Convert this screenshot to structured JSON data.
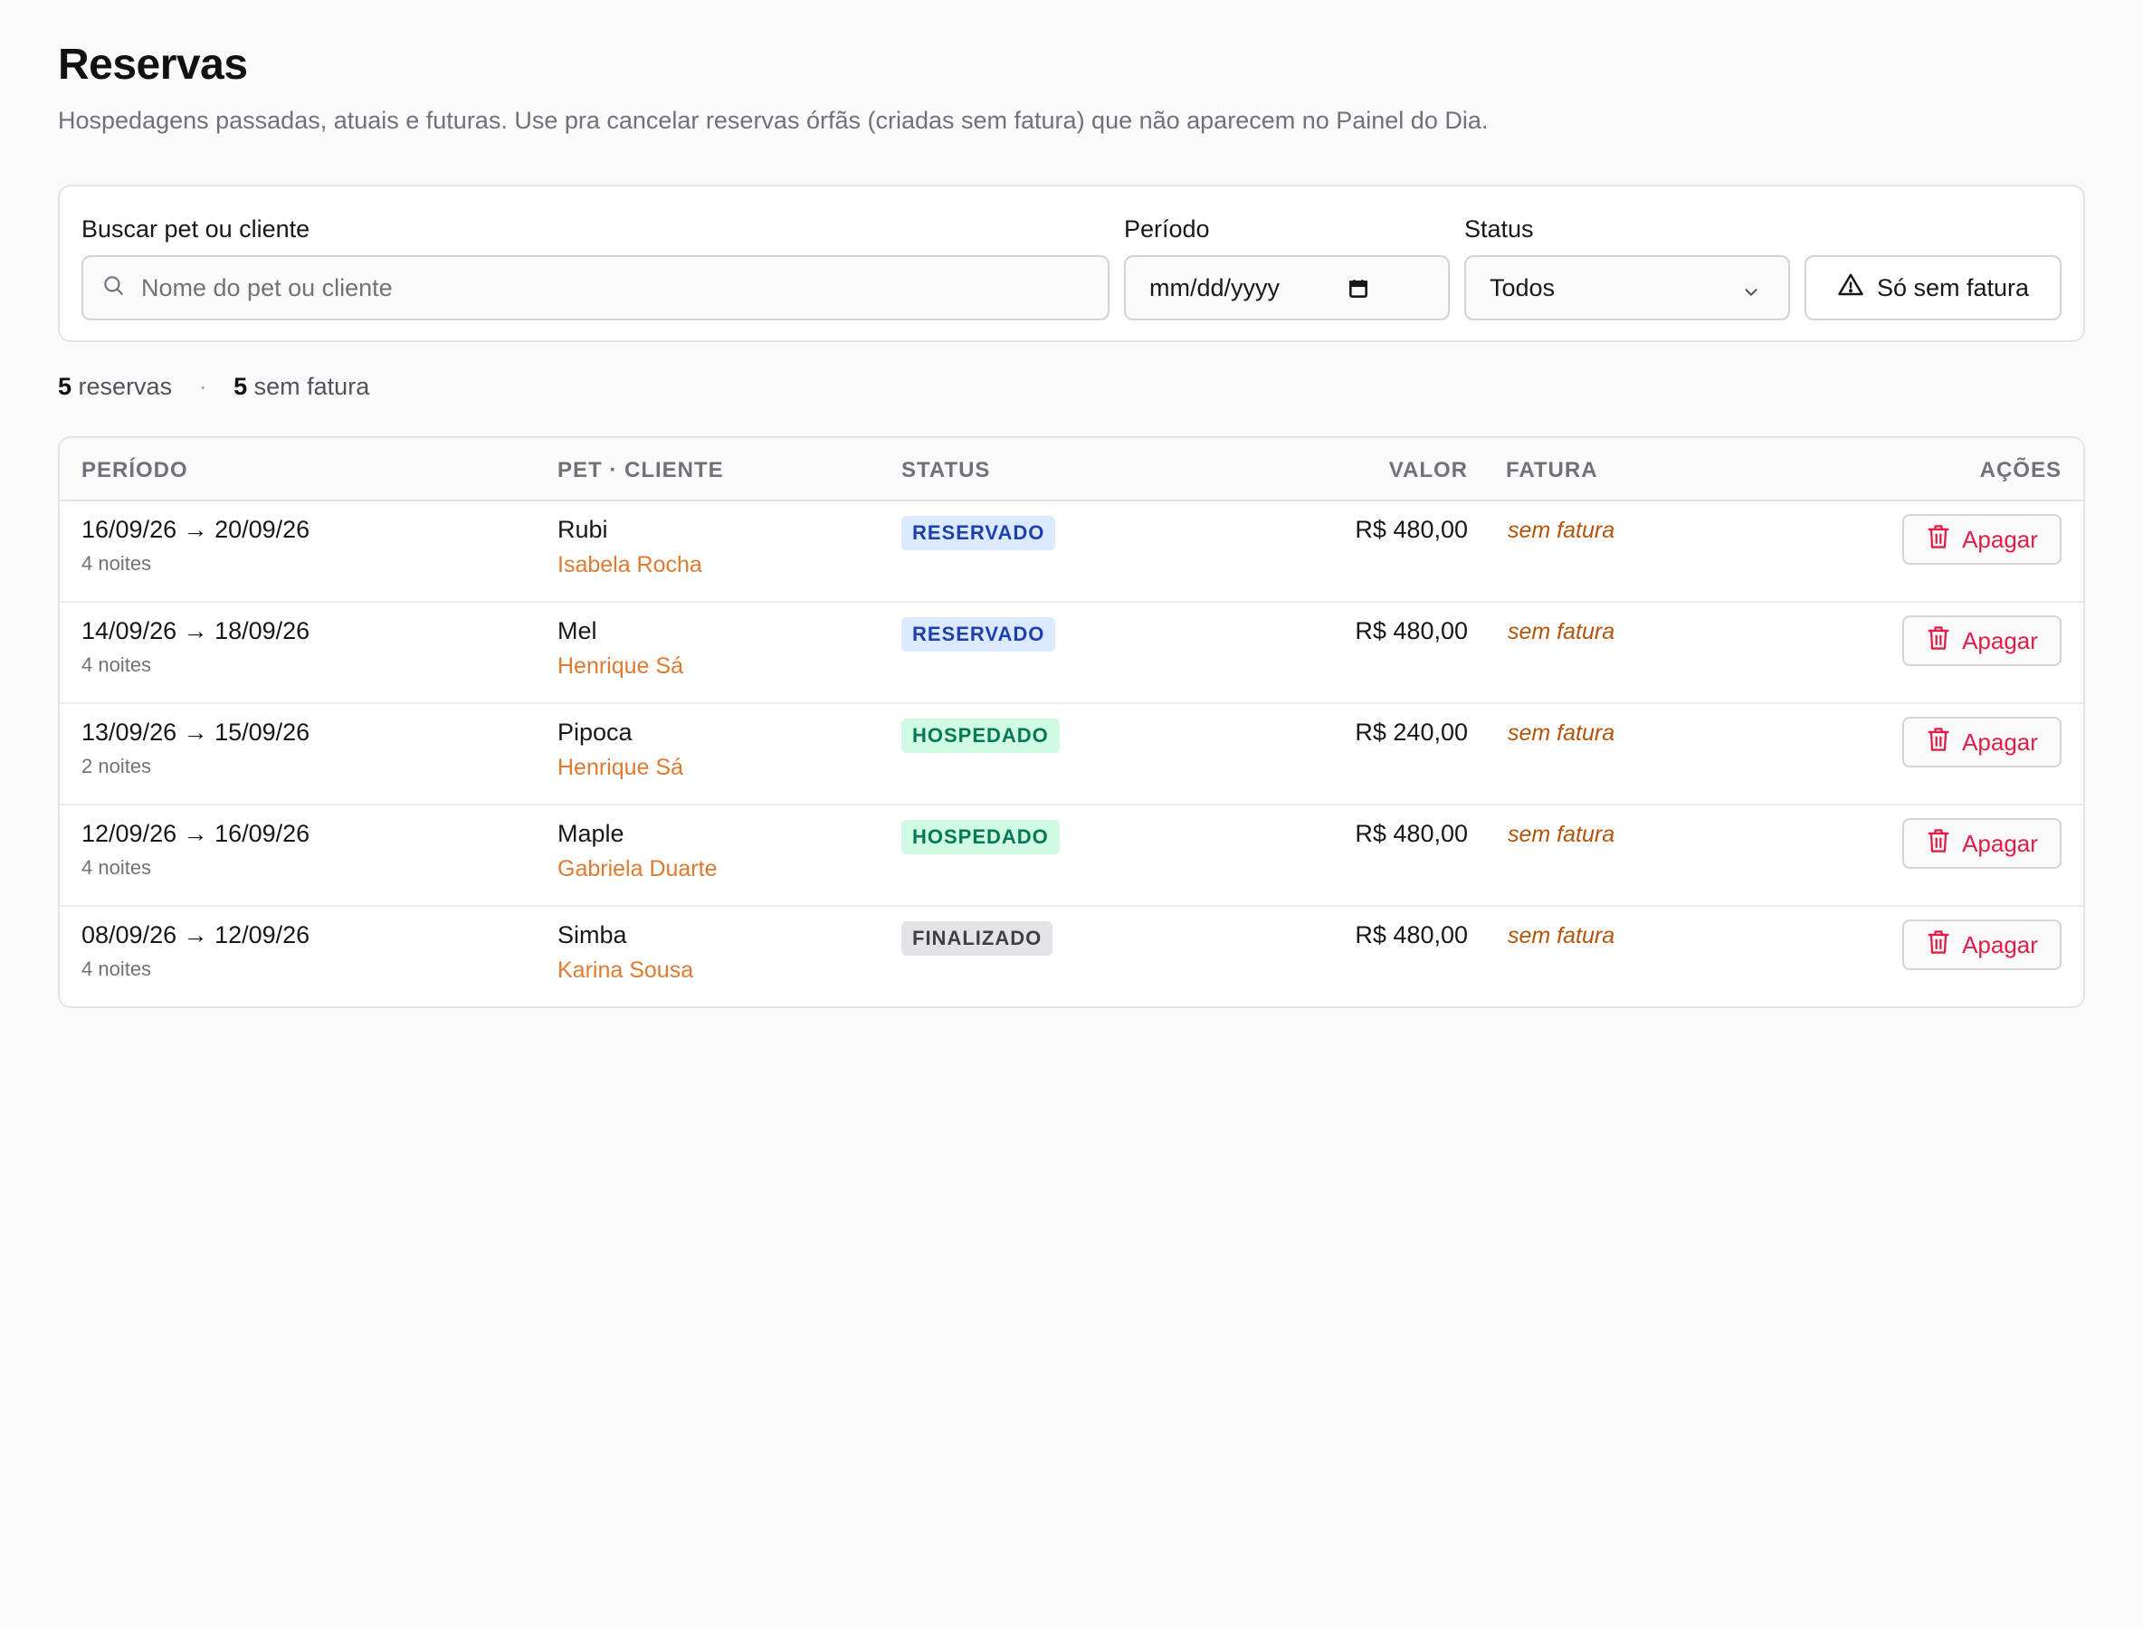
{
  "page": {
    "title": "Reservas",
    "subtitle": "Hospedagens passadas, atuais e futuras. Use pra cancelar reservas órfãs (criadas sem fatura) que não aparecem no Painel do Dia."
  },
  "filters": {
    "search_label": "Buscar pet ou cliente",
    "search_placeholder": "Nome do pet ou cliente",
    "search_icon": "search-icon",
    "period_label": "Período",
    "period_value": "mm/dd/yyyy",
    "period_icon": "calendar-icon",
    "status_label": "Status",
    "status_value": "Todos",
    "status_icon": "chevron-down-icon",
    "toggle_label": "Só sem fatura",
    "toggle_icon": "warning-triangle-icon"
  },
  "summary": {
    "count": "5",
    "count_label": "reservas",
    "separator": "·",
    "no_invoice_count": "5",
    "no_invoice_label": "sem fatura"
  },
  "table": {
    "headers": {
      "period": "PERÍODO",
      "pet_client": "PET · CLIENTE",
      "status": "STATUS",
      "value": "VALOR",
      "invoice": "FATURA",
      "actions": "AÇÕES"
    },
    "rows": [
      {
        "period": "16/09/26 → 20/09/26",
        "nights": "4 noites",
        "pet": "Rubi",
        "client": "Isabela Rocha",
        "status": "RESERVADO",
        "status_kind": "reservado",
        "value": "R$ 480,00",
        "invoice": "sem fatura",
        "action": "Apagar"
      },
      {
        "period": "14/09/26 → 18/09/26",
        "nights": "4 noites",
        "pet": "Mel",
        "client": "Henrique Sá",
        "status": "RESERVADO",
        "status_kind": "reservado",
        "value": "R$ 480,00",
        "invoice": "sem fatura",
        "action": "Apagar"
      },
      {
        "period": "13/09/26 → 15/09/26",
        "nights": "2 noites",
        "pet": "Pipoca",
        "client": "Henrique Sá",
        "status": "HOSPEDADO",
        "status_kind": "hospedado",
        "value": "R$ 240,00",
        "invoice": "sem fatura",
        "action": "Apagar"
      },
      {
        "period": "12/09/26 → 16/09/26",
        "nights": "4 noites",
        "pet": "Maple",
        "client": "Gabriela Duarte",
        "status": "HOSPEDADO",
        "status_kind": "hospedado",
        "value": "R$ 480,00",
        "invoice": "sem fatura",
        "action": "Apagar"
      },
      {
        "period": "08/09/26 → 12/09/26",
        "nights": "4 noites",
        "pet": "Simba",
        "client": "Karina Sousa",
        "status": "FINALIZADO",
        "status_kind": "finalizado",
        "value": "R$ 480,00",
        "invoice": "sem fatura",
        "action": "Apagar"
      }
    ]
  },
  "colors": {
    "accent_client": "#e07a30",
    "invoice_missing": "#b45309",
    "danger": "#e11d48",
    "badge_reservado": "#dbeafe",
    "badge_hospedado": "#d1fae5",
    "badge_finalizado": "#e4e4e7"
  }
}
